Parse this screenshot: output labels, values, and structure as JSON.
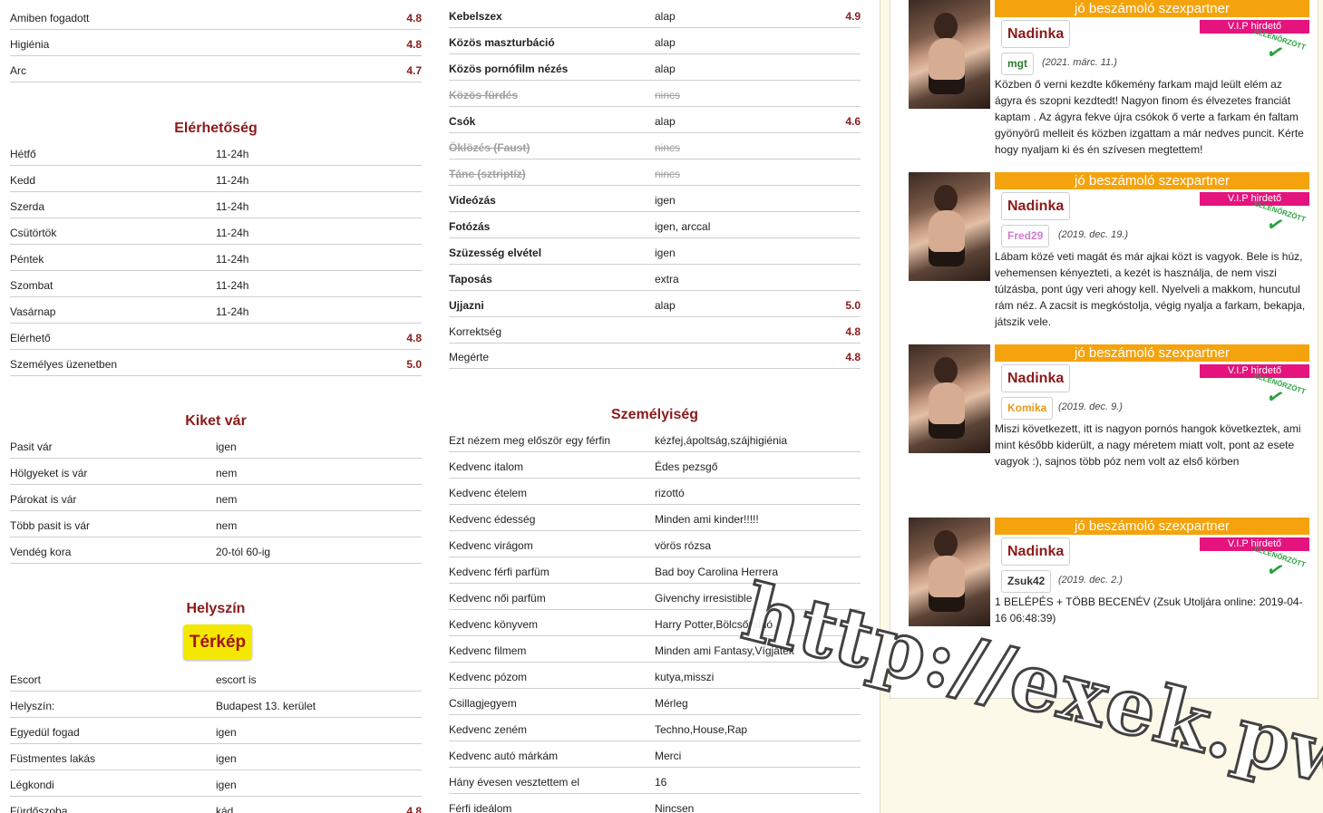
{
  "colA": {
    "rows_top": [
      {
        "k": "Amiben fogadott",
        "v": "",
        "s": "4.8"
      },
      {
        "k": "Higiénia",
        "v": "",
        "s": "4.8"
      },
      {
        "k": "Arc",
        "v": "",
        "s": "4.7"
      }
    ],
    "availability": {
      "title": "Elérhetőség",
      "rows": [
        {
          "k": "Hétfő",
          "v": "11-24h",
          "s": ""
        },
        {
          "k": "Kedd",
          "v": "11-24h",
          "s": ""
        },
        {
          "k": "Szerda",
          "v": "11-24h",
          "s": ""
        },
        {
          "k": "Csütörtök",
          "v": "11-24h",
          "s": ""
        },
        {
          "k": "Péntek",
          "v": "11-24h",
          "s": ""
        },
        {
          "k": "Szombat",
          "v": "11-24h",
          "s": ""
        },
        {
          "k": "Vasárnap",
          "v": "11-24h",
          "s": ""
        },
        {
          "k": "Elérhető",
          "v": "",
          "s": "4.8"
        },
        {
          "k": "Személyes üzenetben",
          "v": "",
          "s": "5.0"
        }
      ]
    },
    "waits_for": {
      "title": "Kiket vár",
      "rows": [
        {
          "k": "Pasit vár",
          "v": "igen",
          "s": ""
        },
        {
          "k": "Hölgyeket is vár",
          "v": "nem",
          "s": ""
        },
        {
          "k": "Párokat is vár",
          "v": "nem",
          "s": ""
        },
        {
          "k": "Több pasit is vár",
          "v": "nem",
          "s": ""
        },
        {
          "k": "Vendég kora",
          "v": "20-tól 60-ig",
          "s": ""
        }
      ]
    },
    "location": {
      "title": "Helyszín",
      "map_button": "Térkép",
      "rows": [
        {
          "k": "Escort",
          "v": "escort is",
          "s": ""
        },
        {
          "k": "Helyszín:",
          "v": "Budapest 13. kerület",
          "s": ""
        },
        {
          "k": "Egyedül fogad",
          "v": "igen",
          "s": ""
        },
        {
          "k": "Füstmentes lakás",
          "v": "igen",
          "s": ""
        },
        {
          "k": "Légkondi",
          "v": "igen",
          "s": ""
        },
        {
          "k": "Fürdőszoba",
          "v": "kád",
          "s": "4.8"
        }
      ]
    }
  },
  "colB": {
    "services": [
      {
        "k": "Kebelszex",
        "v": "alap",
        "s": "4.9",
        "strike": false,
        "plain": false
      },
      {
        "k": "Közös maszturbáció",
        "v": "alap",
        "s": "",
        "strike": false,
        "plain": false
      },
      {
        "k": "Közös pornófilm nézés",
        "v": "alap",
        "s": "",
        "strike": false,
        "plain": false
      },
      {
        "k": "Közös fürdés",
        "v": "nincs",
        "s": "",
        "strike": true,
        "plain": false
      },
      {
        "k": "Csók",
        "v": "alap",
        "s": "4.6",
        "strike": false,
        "plain": false
      },
      {
        "k": "Öklözés (Faust)",
        "v": "nincs",
        "s": "",
        "strike": true,
        "plain": false
      },
      {
        "k": "Tánc (sztriptíz)",
        "v": "nincs",
        "s": "",
        "strike": true,
        "plain": false
      },
      {
        "k": "Videózás",
        "v": "igen",
        "s": "",
        "strike": false,
        "plain": false
      },
      {
        "k": "Fotózás",
        "v": "igen, arccal",
        "s": "",
        "strike": false,
        "plain": false
      },
      {
        "k": "Szüzesség elvétel",
        "v": "igen",
        "s": "",
        "strike": false,
        "plain": false
      },
      {
        "k": "Taposás",
        "v": "extra",
        "s": "",
        "strike": false,
        "plain": false
      },
      {
        "k": "Ujjazni",
        "v": "alap",
        "s": "5.0",
        "strike": false,
        "plain": false
      },
      {
        "k": "Korrektség",
        "v": "",
        "s": "4.8",
        "strike": false,
        "plain": true
      },
      {
        "k": "Megérte",
        "v": "",
        "s": "4.8",
        "strike": false,
        "plain": true
      }
    ],
    "personality": {
      "title": "Személyiség",
      "rows": [
        {
          "k": "Ezt nézem meg először egy férfin",
          "v": "kézfej,ápoltság,szájhigiénia"
        },
        {
          "k": "Kedvenc italom",
          "v": "Édes pezsgő"
        },
        {
          "k": "Kedvenc ételem",
          "v": "rizottó"
        },
        {
          "k": "Kedvenc édesség",
          "v": "Minden ami kinder!!!!!"
        },
        {
          "k": "Kedvenc virágom",
          "v": "vörös rózsa"
        },
        {
          "k": "Kedvenc férfi parfüm",
          "v": "Bad boy Carolina Herrera"
        },
        {
          "k": "Kedvenc női parfüm",
          "v": "Givenchy irresistible"
        },
        {
          "k": "Kedvenc könyvem",
          "v": "Harry Potter,Bölcsőrabló"
        },
        {
          "k": "Kedvenc filmem",
          "v": "Minden ami Fantasy,Vígjáték"
        },
        {
          "k": "Kedvenc pózom",
          "v": "kutya,misszi"
        },
        {
          "k": "Csillagjegyem",
          "v": "Mérleg"
        },
        {
          "k": "Kedvenc zeném",
          "v": "Techno,House,Rap"
        },
        {
          "k": "Kedvenc autó márkám",
          "v": "Merci"
        },
        {
          "k": "Hány évesen vesztettem el",
          "v": "16"
        },
        {
          "k": "Férfi ideálom",
          "v": "Nincsen"
        }
      ]
    }
  },
  "reviews": {
    "banner": "jó beszámoló szexpartner",
    "vip": "V.I.P hirdető",
    "stamp": "ELLENŐRZÖTT",
    "items": [
      {
        "name": "Nadinka",
        "user": "mgt",
        "user_color": "#2e7d32",
        "date": "(2021. márc. 11.)",
        "text": "Közben ő verni kezdte kőkemény farkam majd leült elém az ágyra és szopni kezdtedt! Nagyon finom és élvezetes franciát kaptam . Az ágyra fekve újra csókok ő verte a farkam én faltam gyönyörű melleit és közben izgattam a már nedves puncit. Kérte hogy nyaljam ki és én szívesen megtettem!"
      },
      {
        "name": "Nadinka",
        "user": "Fred29",
        "user_color": "#d07ad0",
        "date": "(2019. dec. 19.)",
        "text": "Lábam közé veti magát és már ajkai közt is vagyok. Bele is húz, vehemensen kényezteti, a kezét is használja, de nem viszi túlzásba, pont úgy veri ahogy kell. Nyelveli a makkom, huncutul rám néz. A zacsit is megkóstolja, végig nyalja a farkam, bekapja, játszik vele."
      },
      {
        "name": "Nadinka",
        "user": "Komika",
        "user_color": "#e39a1a",
        "date": "(2019. dec. 9.)",
        "text": "Miszi következett, itt is nagyon pornós hangok következtek, ami mint később kiderült, a nagy méretem miatt volt, pont az esete vagyok :), sajnos több póz nem volt az első körben"
      },
      {
        "name": "Nadinka",
        "user": "Zsuk42",
        "user_color": "#333333",
        "date": "(2019. dec. 2.)",
        "text": "1 BELÉPÉS + TÖBB BECENÉV (Zsuk Utoljára online: 2019-04-16 06:48:39)"
      }
    ]
  },
  "watermark": "http://exek.pw"
}
